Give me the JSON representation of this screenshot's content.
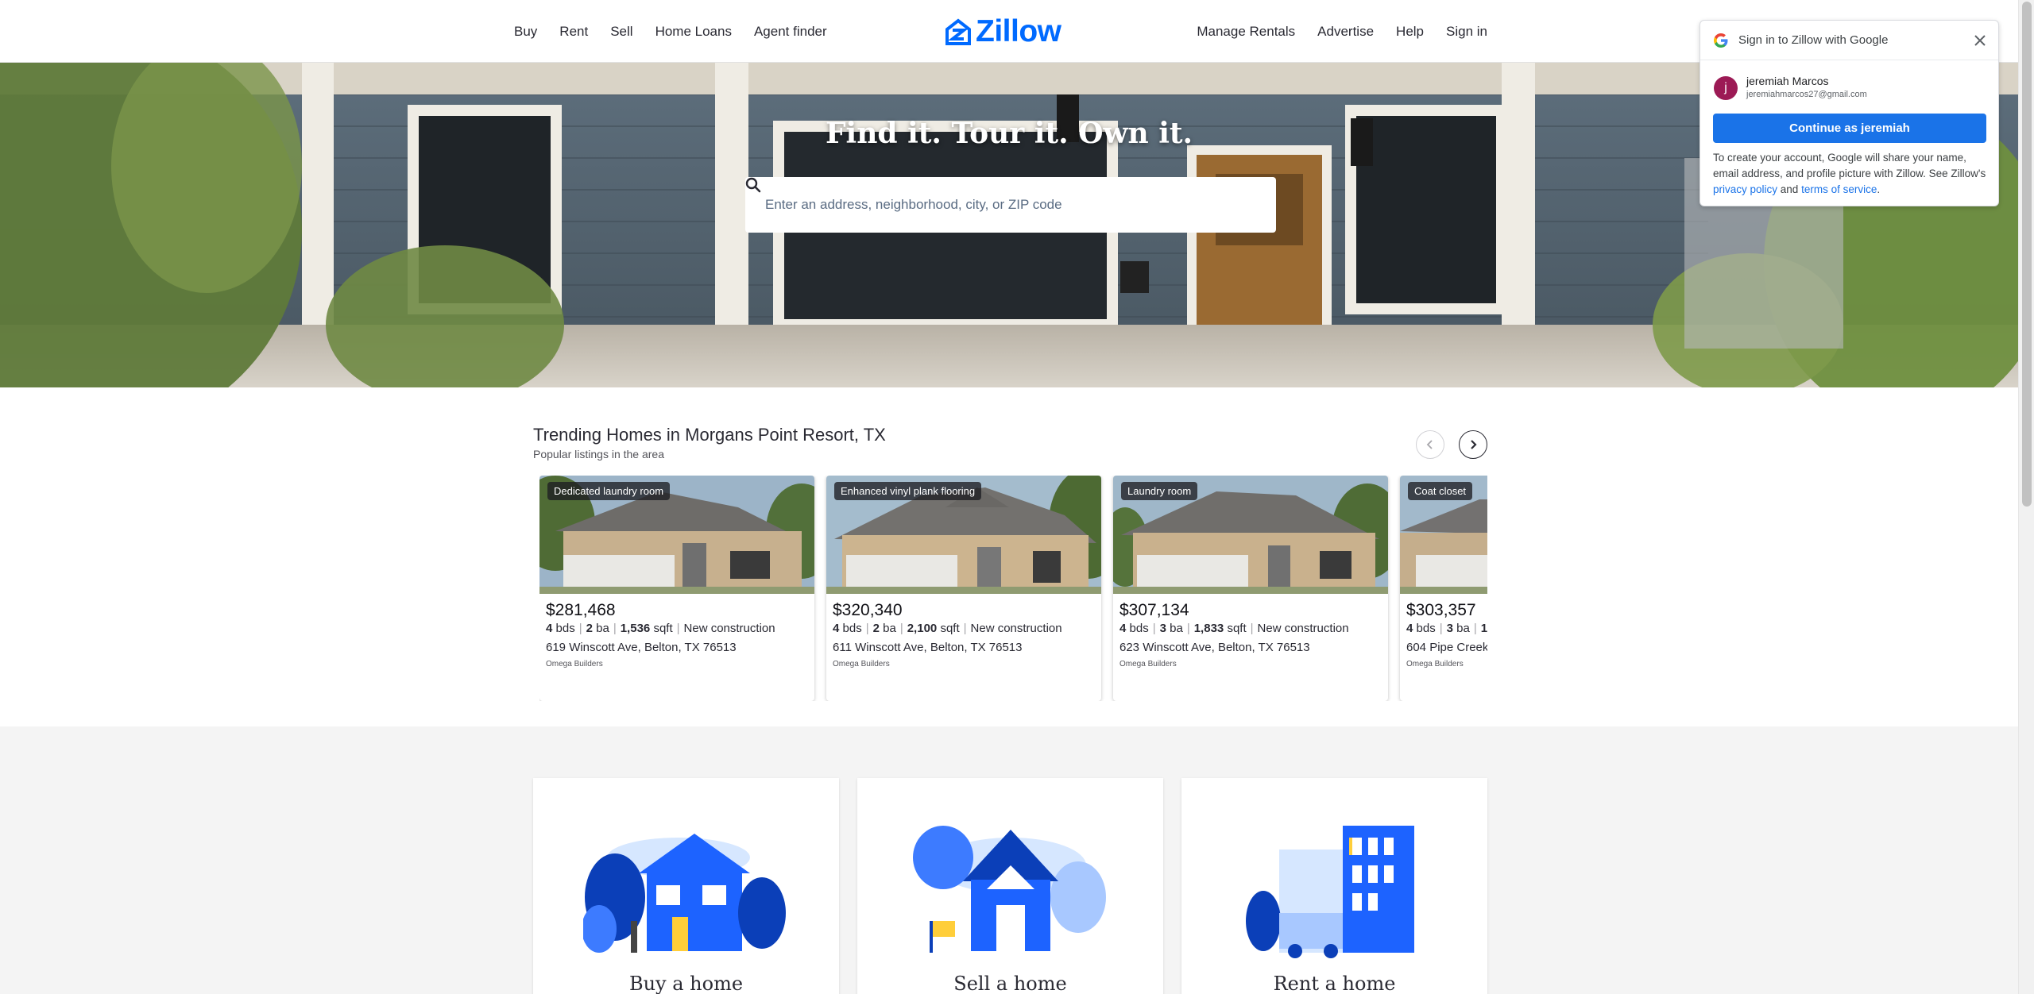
{
  "nav": {
    "left": [
      "Buy",
      "Rent",
      "Sell",
      "Home Loans",
      "Agent finder"
    ],
    "right": [
      "Manage Rentals",
      "Advertise",
      "Help",
      "Sign in"
    ],
    "logo": "Zillow"
  },
  "hero": {
    "title": "Find it. Tour it. Own it.",
    "search_placeholder": "Enter an address, neighborhood, city, or ZIP code"
  },
  "trending": {
    "title": "Trending Homes in Morgans Point Resort, TX",
    "subtitle": "Popular listings in the area",
    "cards": [
      {
        "badge": "Dedicated laundry room",
        "price": "$281,468",
        "beds": "4",
        "beds_label": "bds",
        "baths": "2",
        "baths_label": "ba",
        "sqft": "1,536",
        "sqft_label": "sqft",
        "status": "New construction",
        "address": "619 Winscott Ave, Belton, TX 76513",
        "broker": "Omega Builders"
      },
      {
        "badge": "Enhanced vinyl plank flooring",
        "price": "$320,340",
        "beds": "4",
        "beds_label": "bds",
        "baths": "2",
        "baths_label": "ba",
        "sqft": "2,100",
        "sqft_label": "sqft",
        "status": "New construction",
        "address": "611 Winscott Ave, Belton, TX 76513",
        "broker": "Omega Builders"
      },
      {
        "badge": "Laundry room",
        "price": "$307,134",
        "beds": "4",
        "beds_label": "bds",
        "baths": "3",
        "baths_label": "ba",
        "sqft": "1,833",
        "sqft_label": "sqft",
        "status": "New construction",
        "address": "623 Winscott Ave, Belton, TX 76513",
        "broker": "Omega Builders"
      },
      {
        "badge": "Coat closet",
        "price": "$303,357",
        "beds": "4",
        "beds_label": "bds",
        "baths": "3",
        "baths_label": "ba",
        "sqft": "1",
        "sqft_label": "",
        "status": "",
        "address": "604 Pipe Creek",
        "broker": "Omega Builders"
      }
    ]
  },
  "tiles": [
    {
      "title": "Buy a home"
    },
    {
      "title": "Sell a home"
    },
    {
      "title": "Rent a home"
    }
  ],
  "google_popup": {
    "title": "Sign in to Zillow with Google",
    "avatar_letter": "j",
    "name": "jeremiah Marcos",
    "email": "jeremiahmarcos27@gmail.com",
    "continue_label": "Continue as jeremiah",
    "text_before": "To create your account, Google will share your name, email address, and profile picture with Zillow. See Zillow's ",
    "privacy_link": "privacy policy",
    "text_and": " and ",
    "terms_link": "terms of service",
    "text_end": "."
  },
  "colors": {
    "brand": "#006aff",
    "google_blue": "#1a73e8"
  }
}
